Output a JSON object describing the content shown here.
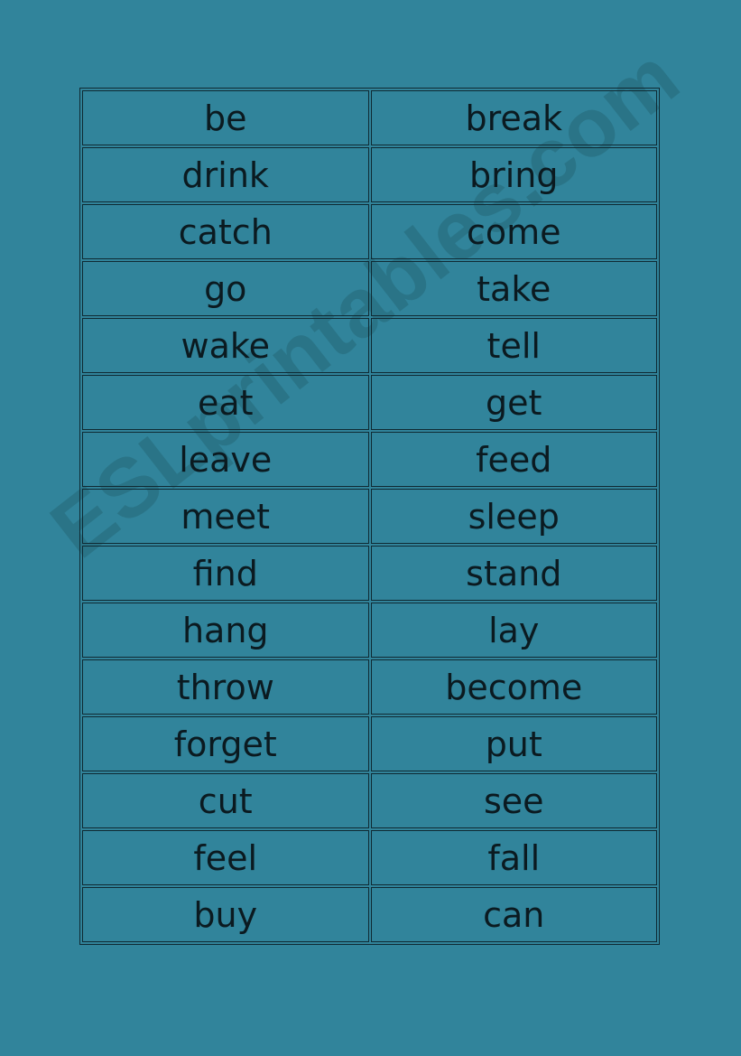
{
  "page": {
    "background_color": "#31849b",
    "watermark": "ESLprintables.com"
  },
  "table": {
    "rows": [
      [
        "be",
        "break"
      ],
      [
        "drink",
        "bring"
      ],
      [
        "catch",
        "come"
      ],
      [
        "go",
        "take"
      ],
      [
        "wake",
        "tell"
      ],
      [
        "eat",
        "get"
      ],
      [
        "leave",
        "feed"
      ],
      [
        "meet",
        "sleep"
      ],
      [
        "find",
        "stand"
      ],
      [
        "hang",
        "lay"
      ],
      [
        "throw",
        "become"
      ],
      [
        "forget",
        "put"
      ],
      [
        "cut",
        "see"
      ],
      [
        "feel",
        "fall"
      ],
      [
        "buy",
        "can"
      ]
    ]
  }
}
